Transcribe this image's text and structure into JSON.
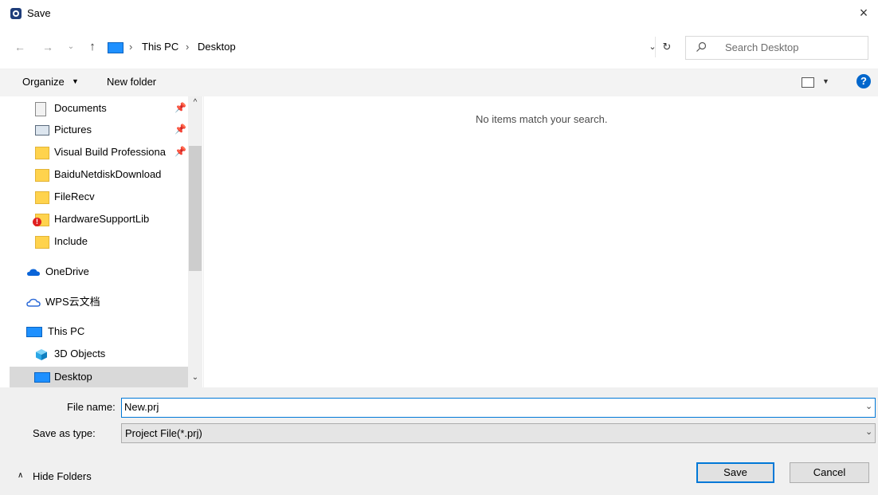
{
  "window": {
    "title": "Save",
    "close_glyph": "×"
  },
  "address": {
    "breadcrumbs": [
      "This PC",
      "Desktop"
    ],
    "separator": "›",
    "search_placeholder": "Search Desktop"
  },
  "toolbar": {
    "organize_label": "Organize",
    "new_folder_label": "New folder",
    "help_label": "?"
  },
  "nav": {
    "items": [
      {
        "label": "Documents",
        "icon": "documents-icon",
        "pinned": true
      },
      {
        "label": "Pictures",
        "icon": "pictures-icon",
        "pinned": true
      },
      {
        "label": "Visual Build Professiona",
        "icon": "folder-icon",
        "pinned": true
      },
      {
        "label": "BaiduNetdiskDownload",
        "icon": "folder-icon"
      },
      {
        "label": "FileRecv",
        "icon": "folder-icon"
      },
      {
        "label": "HardwareSupportLib",
        "icon": "warning-folder-icon"
      },
      {
        "label": "Include",
        "icon": "folder-icon"
      },
      {
        "label": "OneDrive",
        "icon": "onedrive-icon"
      },
      {
        "label": "WPS云文档",
        "icon": "wps-cloud-icon"
      },
      {
        "label": "This PC",
        "icon": "this-pc-icon"
      },
      {
        "label": "3D Objects",
        "icon": "3d-objects-icon"
      },
      {
        "label": "Desktop",
        "icon": "desktop-icon",
        "selected": true
      }
    ]
  },
  "content": {
    "empty_message": "No items match your search."
  },
  "form": {
    "file_name_label": "File name:",
    "file_name_value": "New.prj",
    "save_as_type_label": "Save as type:",
    "save_as_type_value": "Project File(*.prj)"
  },
  "footer": {
    "hide_folders_label": "Hide Folders",
    "save_label": "Save",
    "cancel_label": "Cancel"
  },
  "colors": {
    "accent": "#0078d7",
    "folder": "#ffd34d",
    "help": "#0066cc",
    "selection": "#d9d9d9"
  }
}
